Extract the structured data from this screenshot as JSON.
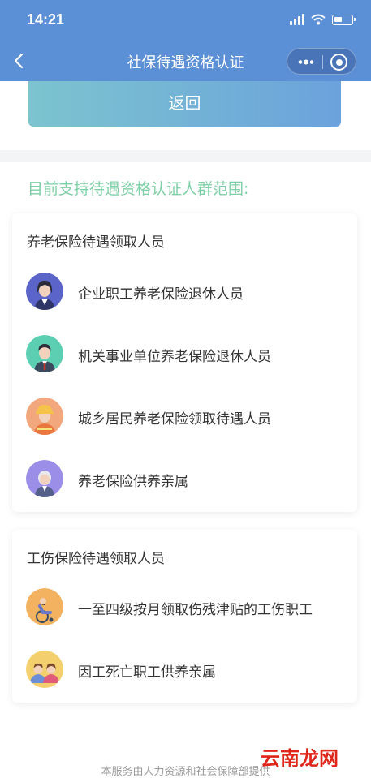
{
  "status_bar": {
    "time": "14:21"
  },
  "nav": {
    "title": "社保待遇资格认证"
  },
  "return_button": {
    "label": "返回"
  },
  "section_title": "目前支持待遇资格认证人群范围:",
  "groups": [
    {
      "title": "养老保险待遇领取人员",
      "items": [
        {
          "label": "企业职工养老保险退休人员",
          "icon": "female-worker-icon",
          "color": "#5a64c9"
        },
        {
          "label": "机关事业单位养老保险退休人员",
          "icon": "office-worker-icon",
          "color": "#5ccfb2"
        },
        {
          "label": "城乡居民养老保险领取待遇人员",
          "icon": "construction-worker-icon",
          "color": "#f2a77d"
        },
        {
          "label": "养老保险供养亲属",
          "icon": "elderly-person-icon",
          "color": "#9b8ee8"
        }
      ]
    },
    {
      "title": "工伤保险待遇领取人员",
      "items": [
        {
          "label": "一至四级按月领取伤残津贴的工伤职工",
          "icon": "wheelchair-user-icon",
          "color": "#f3b25f"
        },
        {
          "label": "因工死亡职工供养亲属",
          "icon": "family-members-icon",
          "color": "#f3cf6e"
        }
      ]
    }
  ],
  "footer": {
    "text": "本服务由人力资源和社会保障部提供"
  },
  "watermark": {
    "text": "云南龙网"
  }
}
